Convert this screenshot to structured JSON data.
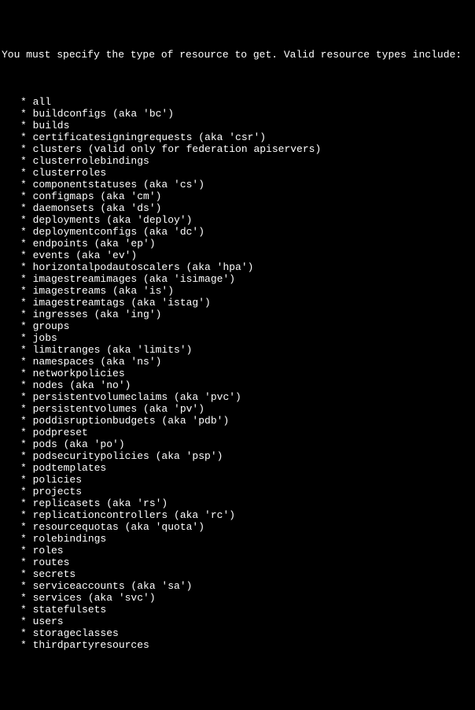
{
  "header": "You must specify the type of resource to get. Valid resource types include:",
  "resources": [
    "* all",
    "* buildconfigs (aka 'bc')",
    "* builds",
    "* certificatesigningrequests (aka 'csr')",
    "* clusters (valid only for federation apiservers)",
    "* clusterrolebindings",
    "* clusterroles",
    "* componentstatuses (aka 'cs')",
    "* configmaps (aka 'cm')",
    "* daemonsets (aka 'ds')",
    "* deployments (aka 'deploy')",
    "* deploymentconfigs (aka 'dc')",
    "* endpoints (aka 'ep')",
    "* events (aka 'ev')",
    "* horizontalpodautoscalers (aka 'hpa')",
    "* imagestreamimages (aka 'isimage')",
    "* imagestreams (aka 'is')",
    "* imagestreamtags (aka 'istag')",
    "* ingresses (aka 'ing')",
    "* groups",
    "* jobs",
    "* limitranges (aka 'limits')",
    "* namespaces (aka 'ns')",
    "* networkpolicies",
    "* nodes (aka 'no')",
    "* persistentvolumeclaims (aka 'pvc')",
    "* persistentvolumes (aka 'pv')",
    "* poddisruptionbudgets (aka 'pdb')",
    "* podpreset",
    "* pods (aka 'po')",
    "* podsecuritypolicies (aka 'psp')",
    "* podtemplates",
    "* policies",
    "* projects",
    "* replicasets (aka 'rs')",
    "* replicationcontrollers (aka 'rc')",
    "* resourcequotas (aka 'quota')",
    "* rolebindings",
    "* roles",
    "* routes",
    "* secrets",
    "* serviceaccounts (aka 'sa')",
    "* services (aka 'svc')",
    "* statefulsets",
    "* users",
    "* storageclasses",
    "* thirdpartyresources"
  ]
}
